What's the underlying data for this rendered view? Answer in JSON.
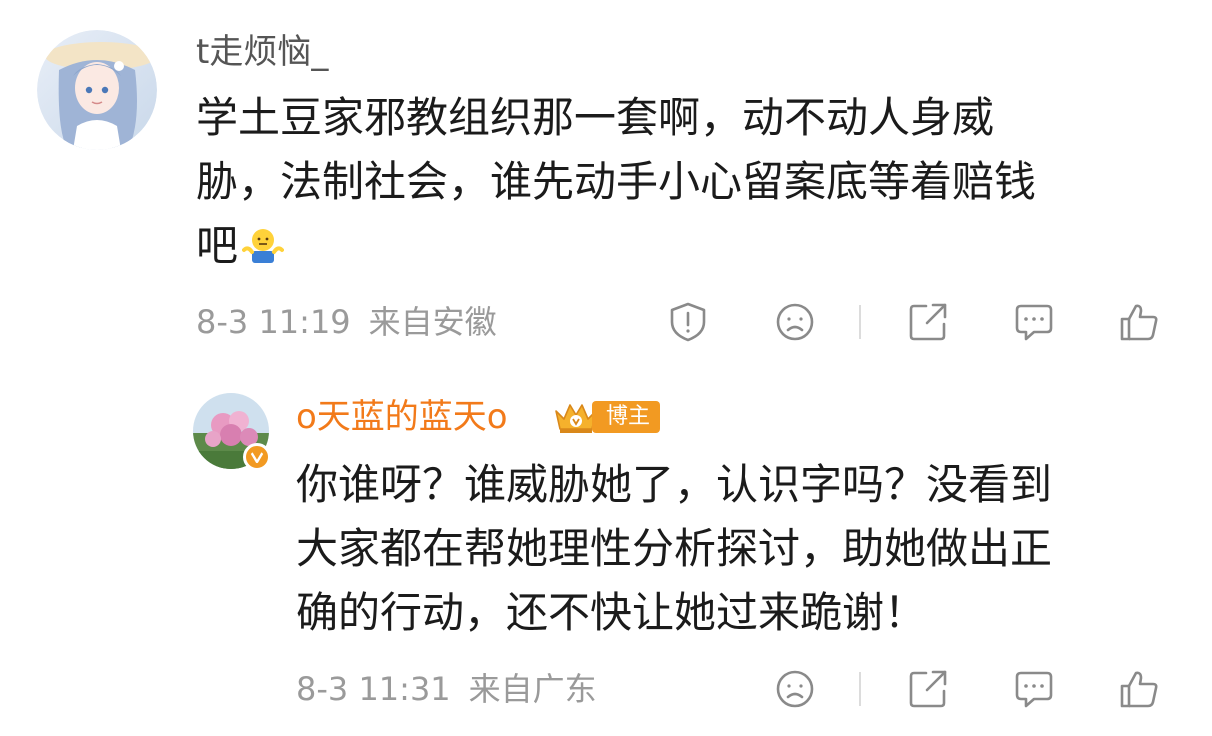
{
  "comments": [
    {
      "username": "t走烦恼_",
      "content_lines": [
        "学土豆家邪教组织那一套啊，动不动人身威",
        "胁，法制社会，谁先动手小心留案底等着赔钱",
        "吧"
      ],
      "timestamp": "8-3 11:19",
      "location": "来自安徽",
      "actions": [
        "report-icon",
        "dislike-face-icon",
        "share-icon",
        "comment-icon",
        "like-icon"
      ]
    },
    {
      "username": "o天蓝的蓝天o",
      "badge": "博主",
      "verified": true,
      "content_lines": [
        "你谁呀？谁威胁她了，认识字吗？没看到",
        "大家都在帮她理性分析探讨，助她做出正",
        "确的行动，还不快让她过来跪谢！"
      ],
      "timestamp": "8-3 11:31",
      "location": "来自广东",
      "actions": [
        "dislike-face-icon",
        "share-icon",
        "comment-icon",
        "like-icon"
      ]
    }
  ],
  "colors": {
    "reply_username": "#f27a1a",
    "blogger_badge": "#f29a22",
    "meta_gray": "#9a9a9a",
    "icon_gray": "#8a8a8a"
  }
}
